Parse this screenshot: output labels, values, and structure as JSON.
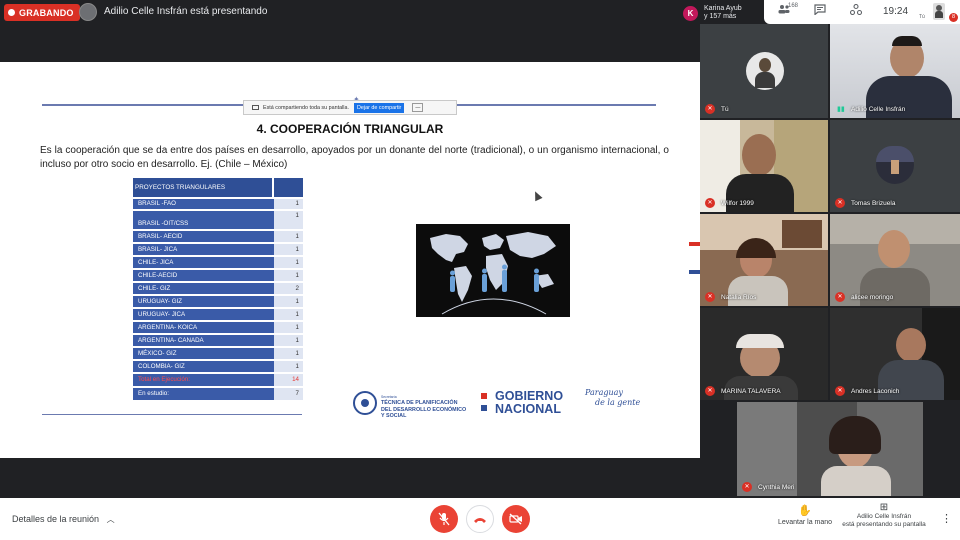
{
  "topbar": {
    "recording_label": "GRABANDO",
    "presenting_text": "Adilio Celle Insfrán está presentando",
    "people_avatar_letter": "K",
    "people_line1": "Karina Ayub",
    "people_line2": "y 157 más"
  },
  "toolbar": {
    "participants_count": "168",
    "time": "19:24",
    "self_label": "Tú",
    "notification_count": "8"
  },
  "share_banner": {
    "text": "Está compartiendo toda su pantalla.",
    "stop_label": "Dejar de compartir",
    "hide_label": "—"
  },
  "slide": {
    "title": "4. COOPERACIÓN TRIANGULAR",
    "body": "Es la cooperación que se da entre dos países en desarrollo, apoyados por un donante del norte (tradicional), o un organismo internacional, o incluso por otro socio en desarrollo. Ej. (Chile – México)",
    "table": {
      "header": "PROYECTOS TRIANGULARES",
      "rows": [
        {
          "name": "BRASIL -FAO",
          "value": "1"
        },
        {
          "name": "BRASIL -OIT/CSS",
          "value": "1"
        },
        {
          "name": "BRASIL- AECID",
          "value": "1"
        },
        {
          "name": "BRASIL- JICA",
          "value": "1"
        },
        {
          "name": "CHILE- JICA",
          "value": "1"
        },
        {
          "name": "CHILE-AECID",
          "value": "1"
        },
        {
          "name": "CHILE- GIZ",
          "value": "2"
        },
        {
          "name": "URUGUAY- GIZ",
          "value": "1"
        },
        {
          "name": "URUGUAY- JICA",
          "value": "1"
        },
        {
          "name": "ARGENTINA- KOICA",
          "value": "1"
        },
        {
          "name": "ARGENTINA- CANADA",
          "value": "1"
        },
        {
          "name": "MÉXICO- GIZ",
          "value": "1"
        },
        {
          "name": "COLOMBIA- GIZ",
          "value": "1"
        },
        {
          "name": "Total en Ejecución:",
          "value": "14"
        },
        {
          "name": "En estudio:",
          "value": "7"
        }
      ]
    },
    "logo_stp_small": "Secretaría",
    "logo_stp_line1": "TÉCNICA DE PLANIFICACIÓN",
    "logo_stp_line2": "DEL DESARROLLO ECONÓMICO",
    "logo_stp_line3": "Y SOCIAL",
    "logo_gob_line1": "GOBIERNO",
    "logo_gob_line2": "NACIONAL",
    "logo_pyg_line1": "Paraguay",
    "logo_pyg_line2": "de la gente"
  },
  "participants": [
    {
      "name": "Tú"
    },
    {
      "name": "Adilio Celle Insfrán"
    },
    {
      "name": "Wilfor 1999"
    },
    {
      "name": "Tomas Brizuela"
    },
    {
      "name": "Natalia Ríos"
    },
    {
      "name": "alicee moringo"
    },
    {
      "name": "MARINA TALAVERA"
    },
    {
      "name": "Andres Laconich"
    },
    {
      "name": "Cynthia Meri"
    }
  ],
  "bottombar": {
    "details_label": "Detalles de la reunión",
    "raise_hand_label": "Levantar la mano",
    "presenting_line1": "Adilio Celle Insfrán",
    "presenting_line2": "está presentando su pantalla"
  },
  "colors": {
    "record_red": "#d93025",
    "end_call_red": "#ea4335",
    "slide_blue": "#2f4f96",
    "background": "#202124"
  },
  "icons": [
    "people-icon",
    "chat-icon",
    "activities-icon",
    "mic-off-icon",
    "end-call-icon",
    "camera-off-icon",
    "raise-hand-icon",
    "present-icon",
    "more-vert-icon",
    "chevron-up-icon"
  ]
}
